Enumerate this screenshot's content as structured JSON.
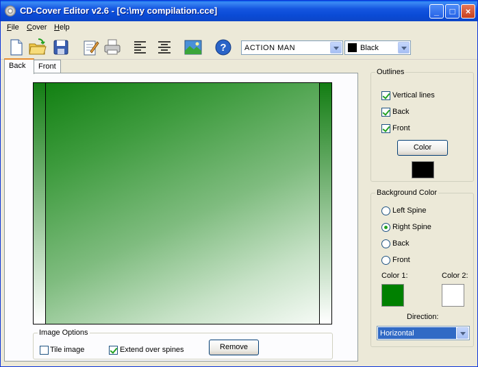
{
  "window": {
    "title": "CD-Cover Editor v2.6 - [C:\\my compilation.cce]",
    "min_glyph": "_",
    "max_glyph": "□",
    "close_glyph": "×"
  },
  "menu": {
    "items": [
      {
        "label": "File",
        "accel": "F",
        "rest": "ile"
      },
      {
        "label": "Cover",
        "accel": "C",
        "rest": "over"
      },
      {
        "label": "Help",
        "accel": "H",
        "rest": "elp"
      }
    ]
  },
  "toolbar": {
    "icons": [
      "new-file-icon",
      "open-folder-icon",
      "save-disk-icon",
      "edit-notepad-icon",
      "print-icon",
      "align-left-icon",
      "align-center-icon",
      "image-icon",
      "help-icon"
    ],
    "font_select": {
      "value": "ACTION MAN"
    },
    "color_select": {
      "value": "Black",
      "swatch_color": "#000000"
    }
  },
  "tabs": [
    {
      "label": "Back",
      "active": true
    },
    {
      "label": "Front",
      "active": false
    }
  ],
  "cover": {
    "spine_color_top": "#137d13",
    "spine_color_bottom": "#ffffff",
    "face_color_start": "#128012",
    "face_color_end": "#f5faf5"
  },
  "image_options": {
    "title": "Image Options",
    "tile_image": {
      "label": "Tile image",
      "checked": false
    },
    "extend_over_spines": {
      "label": "Extend over spines",
      "checked": true
    },
    "remove_label": "Remove"
  },
  "outlines": {
    "title": "Outlines",
    "options": [
      {
        "label": "Vertical lines",
        "checked": true
      },
      {
        "label": "Back",
        "checked": true
      },
      {
        "label": "Front",
        "checked": true
      }
    ],
    "color_button": "Color",
    "color_swatch": "#000000"
  },
  "background_color": {
    "title": "Background Color",
    "options": [
      {
        "label": "Left Spine",
        "selected": false
      },
      {
        "label": "Right Spine",
        "selected": true
      },
      {
        "label": "Back",
        "selected": false
      },
      {
        "label": "Front",
        "selected": false
      }
    ],
    "color1_label": "Color 1:",
    "color2_label": "Color 2:",
    "color1": "#008000",
    "color2": "#ffffff",
    "direction_label": "Direction:",
    "direction_value": "Horizontal"
  }
}
